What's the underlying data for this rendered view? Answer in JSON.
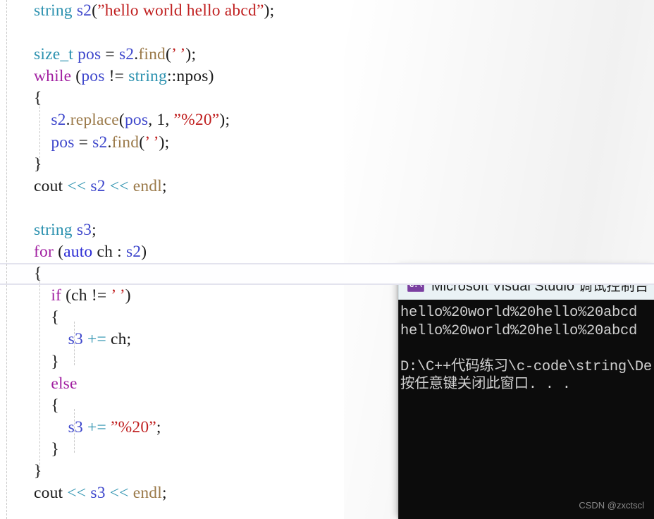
{
  "editor": {
    "name": "code-editor",
    "background": "#ffffff",
    "highlight_line_index": 12,
    "syntax_colors": {
      "type": "#2b91af",
      "control": "#a11fa1",
      "auto": "#2b2bd4",
      "variable": "#3f48cc",
      "function": "#9b7a4a",
      "operator": "#2b91af",
      "string": "#c02020",
      "plain": "#1b1b1b"
    },
    "lines": [
      {
        "indent": 0,
        "tokens": [
          {
            "t": "string",
            "c": "k-type"
          },
          {
            "t": " ",
            "c": "plain"
          },
          {
            "t": "s2",
            "c": "id-var"
          },
          {
            "t": "(",
            "c": "plain"
          },
          {
            "t": "”hello world hello abcd”",
            "c": "str"
          },
          {
            "t": ")",
            "c": "plain"
          },
          {
            "t": ";",
            "c": "plain"
          }
        ]
      },
      {
        "indent": 0,
        "tokens": []
      },
      {
        "indent": 0,
        "tokens": [
          {
            "t": "size_t",
            "c": "k-type"
          },
          {
            "t": " ",
            "c": "plain"
          },
          {
            "t": "pos",
            "c": "id-var"
          },
          {
            "t": " = ",
            "c": "plain"
          },
          {
            "t": "s2",
            "c": "id-var"
          },
          {
            "t": ".",
            "c": "plain"
          },
          {
            "t": "find",
            "c": "id-fn"
          },
          {
            "t": "(",
            "c": "plain"
          },
          {
            "t": "’ ’",
            "c": "chr"
          },
          {
            "t": ")",
            "c": "plain"
          },
          {
            "t": ";",
            "c": "plain"
          }
        ]
      },
      {
        "indent": 0,
        "tokens": [
          {
            "t": "while",
            "c": "k-ctrl"
          },
          {
            "t": " (",
            "c": "plain"
          },
          {
            "t": "pos",
            "c": "id-var"
          },
          {
            "t": " != ",
            "c": "plain"
          },
          {
            "t": "string",
            "c": "k-type"
          },
          {
            "t": "::npos",
            "c": "plain"
          },
          {
            "t": ")",
            "c": "plain"
          }
        ]
      },
      {
        "indent": 0,
        "tokens": [
          {
            "t": "{",
            "c": "brace"
          }
        ]
      },
      {
        "indent": 1,
        "tokens": [
          {
            "t": "s2",
            "c": "id-var"
          },
          {
            "t": ".",
            "c": "plain"
          },
          {
            "t": "replace",
            "c": "id-fn"
          },
          {
            "t": "(",
            "c": "plain"
          },
          {
            "t": "pos",
            "c": "id-var"
          },
          {
            "t": ", ",
            "c": "plain"
          },
          {
            "t": "1",
            "c": "plain"
          },
          {
            "t": ", ",
            "c": "plain"
          },
          {
            "t": "”%20”",
            "c": "str"
          },
          {
            "t": ")",
            "c": "plain"
          },
          {
            "t": ";",
            "c": "plain"
          }
        ]
      },
      {
        "indent": 1,
        "tokens": [
          {
            "t": "pos",
            "c": "id-var"
          },
          {
            "t": " = ",
            "c": "plain"
          },
          {
            "t": "s2",
            "c": "id-var"
          },
          {
            "t": ".",
            "c": "plain"
          },
          {
            "t": "find",
            "c": "id-fn"
          },
          {
            "t": "(",
            "c": "plain"
          },
          {
            "t": "’ ’",
            "c": "chr"
          },
          {
            "t": ")",
            "c": "plain"
          },
          {
            "t": ";",
            "c": "plain"
          }
        ]
      },
      {
        "indent": 0,
        "tokens": [
          {
            "t": "}",
            "c": "brace"
          }
        ]
      },
      {
        "indent": 0,
        "tokens": [
          {
            "t": "cout",
            "c": "plain"
          },
          {
            "t": " ",
            "c": "plain"
          },
          {
            "t": "<<",
            "c": "op"
          },
          {
            "t": " ",
            "c": "plain"
          },
          {
            "t": "s2",
            "c": "id-var"
          },
          {
            "t": " ",
            "c": "plain"
          },
          {
            "t": "<<",
            "c": "op"
          },
          {
            "t": " ",
            "c": "plain"
          },
          {
            "t": "endl",
            "c": "id-fn"
          },
          {
            "t": ";",
            "c": "plain"
          }
        ]
      },
      {
        "indent": 0,
        "tokens": []
      },
      {
        "indent": 0,
        "tokens": [
          {
            "t": "string",
            "c": "k-type"
          },
          {
            "t": " ",
            "c": "plain"
          },
          {
            "t": "s3",
            "c": "id-var"
          },
          {
            "t": ";",
            "c": "plain"
          }
        ]
      },
      {
        "indent": 0,
        "tokens": [
          {
            "t": "for",
            "c": "k-ctrl"
          },
          {
            "t": " (",
            "c": "plain"
          },
          {
            "t": "auto",
            "c": "k-auto"
          },
          {
            "t": " ch : ",
            "c": "plain"
          },
          {
            "t": "s2",
            "c": "id-var"
          },
          {
            "t": ")",
            "c": "plain"
          }
        ]
      },
      {
        "indent": 0,
        "tokens": [
          {
            "t": "{",
            "c": "brace"
          }
        ]
      },
      {
        "indent": 1,
        "tokens": [
          {
            "t": "if",
            "c": "k-ctrl"
          },
          {
            "t": " (ch != ",
            "c": "plain"
          },
          {
            "t": "’ ’",
            "c": "chr"
          },
          {
            "t": ")",
            "c": "plain"
          }
        ]
      },
      {
        "indent": 1,
        "tokens": [
          {
            "t": "{",
            "c": "brace"
          }
        ]
      },
      {
        "indent": 2,
        "tokens": [
          {
            "t": "s3",
            "c": "id-var"
          },
          {
            "t": " ",
            "c": "plain"
          },
          {
            "t": "+=",
            "c": "op"
          },
          {
            "t": " ch;",
            "c": "plain"
          }
        ]
      },
      {
        "indent": 1,
        "tokens": [
          {
            "t": "}",
            "c": "brace"
          }
        ]
      },
      {
        "indent": 1,
        "tokens": [
          {
            "t": "else",
            "c": "k-ctrl"
          }
        ]
      },
      {
        "indent": 1,
        "tokens": [
          {
            "t": "{",
            "c": "brace"
          }
        ]
      },
      {
        "indent": 2,
        "tokens": [
          {
            "t": "s3",
            "c": "id-var"
          },
          {
            "t": " ",
            "c": "plain"
          },
          {
            "t": "+=",
            "c": "op"
          },
          {
            "t": " ",
            "c": "plain"
          },
          {
            "t": "”%20”",
            "c": "str"
          },
          {
            "t": ";",
            "c": "plain"
          }
        ]
      },
      {
        "indent": 1,
        "tokens": [
          {
            "t": "}",
            "c": "brace"
          }
        ]
      },
      {
        "indent": 0,
        "tokens": [
          {
            "t": "}",
            "c": "brace"
          }
        ]
      },
      {
        "indent": 0,
        "tokens": [
          {
            "t": "cout",
            "c": "plain"
          },
          {
            "t": " ",
            "c": "plain"
          },
          {
            "t": "<<",
            "c": "op"
          },
          {
            "t": " ",
            "c": "plain"
          },
          {
            "t": "s3",
            "c": "id-var"
          },
          {
            "t": " ",
            "c": "plain"
          },
          {
            "t": "<<",
            "c": "op"
          },
          {
            "t": " ",
            "c": "plain"
          },
          {
            "t": "endl",
            "c": "id-fn"
          },
          {
            "t": ";",
            "c": "plain"
          }
        ]
      }
    ],
    "plain_text": "string s2(”hello world hello abcd”);\n\nsize_t pos = s2.find(’ ’);\nwhile (pos != string::npos)\n{\n    s2.replace(pos, 1, ”%20”);\n    pos = s2.find(’ ’);\n}\ncout << s2 << endl;\n\nstring s3;\nfor (auto ch : s2)\n{\n    if (ch != ’ ’)\n    {\n        s3 += ch;\n    }\n    else\n    {\n        s3 += ”%20”;\n    }\n}\ncout << s3 << endl;"
  },
  "console": {
    "title": "Microsoft Visual Studio 调试控制台",
    "icon": "console-cmd-icon",
    "icon_glyph": "C:\\",
    "titlebar_color": "#eaf2f5",
    "background": "#0c0c0c",
    "text_color": "#cfcfcf",
    "output": [
      "hello%20world%20hello%20abcd",
      "hello%20world%20hello%20abcd",
      "",
      "D:\\C++代码练习\\c-code\\string\\De",
      "按任意键关闭此窗口. . ."
    ]
  },
  "watermark": {
    "text": "CSDN @zxctscl"
  }
}
